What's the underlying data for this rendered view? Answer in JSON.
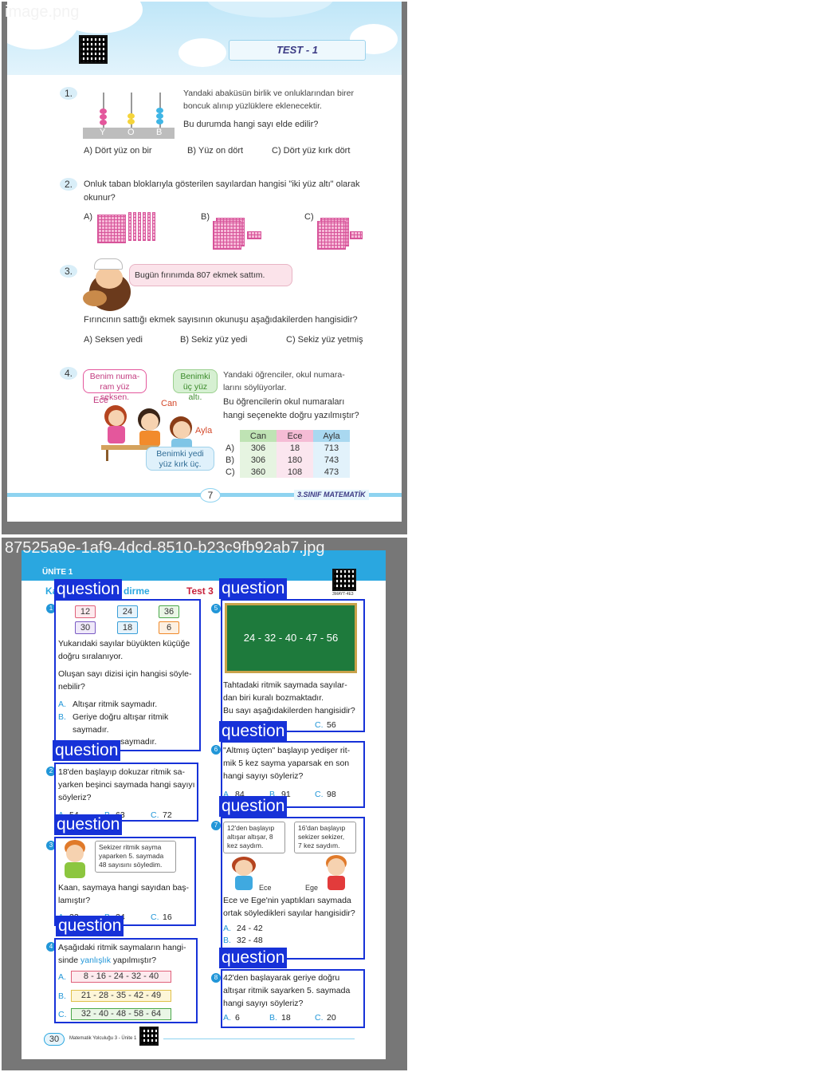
{
  "image1": {
    "filename": "image.png",
    "test_title": "TEST - 1",
    "page_number": "7",
    "footer": "3.SINIF MATEMATİK",
    "q1": {
      "num": "1.",
      "abacus_labels": [
        "Y",
        "O",
        "B"
      ],
      "text1": "Yandaki abaküsün birlik ve onluklarından birer",
      "text2": "boncuk alınıp yüzlüklere eklenecektir.",
      "question": "Bu durumda hangi sayı elde edilir?",
      "options": [
        "A) Dört yüz on bir",
        "B) Yüz on dört",
        "C) Dört yüz kırk dört"
      ]
    },
    "q2": {
      "num": "2.",
      "text1": "Onluk taban bloklarıyla gösterilen sayılardan hangisi \"iki yüz altı\" olarak",
      "text2": "okunur?",
      "options": [
        "A)",
        "B)",
        "C)"
      ]
    },
    "q3": {
      "num": "3.",
      "bubble": "Bugün fırınımda 807 ekmek sattım.",
      "question": "Fırıncının sattığı ekmek sayısının okunuşu aşağıdakilerden hangisidir?",
      "options": [
        "A) Seksen yedi",
        "B) Sekiz yüz yedi",
        "C) Sekiz yüz yetmiş"
      ]
    },
    "q4": {
      "num": "4.",
      "bubble_ece": "Benim numa- ram yüz seksen.",
      "bubble_can": "Benimki üç yüz altı.",
      "bubble_ayla": "Benimki yedi yüz kırk üç.",
      "name_ece": "Ece",
      "name_can": "Can",
      "name_ayla": "Ayla",
      "text1": "Yandaki öğrenciler, okul numara-",
      "text2": "larını söylüyorlar.",
      "question1": "Bu öğrencilerin okul numaraları",
      "question2": "hangi seçenekte doğru yazılmıştır?",
      "headers": [
        "Can",
        "Ece",
        "Ayla"
      ],
      "rows": [
        {
          "label": "A)",
          "values": [
            "306",
            "18",
            "713"
          ]
        },
        {
          "label": "B)",
          "values": [
            "306",
            "180",
            "743"
          ]
        },
        {
          "label": "C)",
          "values": [
            "360",
            "108",
            "473"
          ]
        }
      ]
    }
  },
  "image2": {
    "filename": "87525a9e-1af9-4dcd-8510-b23c9fb92ab7.jpg",
    "unit": "ÜNİTE 1",
    "header_left": "Ka",
    "header_mid": "dirme",
    "test": "Test 3",
    "qr_code_text": "3MAYT-4E3",
    "labels": [
      "question",
      "question",
      "question",
      "question",
      "question",
      "question",
      "question",
      "question"
    ],
    "q1": {
      "num": "1",
      "numbers": [
        "12",
        "24",
        "36",
        "30",
        "18",
        "6"
      ],
      "text": [
        "Yukarıdaki sayılar büyükten küçüğe",
        "doğru sıralanıyor."
      ],
      "question": [
        "Oluşan sayı dizisi için hangisi söyle-",
        "nebilir?"
      ],
      "optA": "Altışar ritmik saymadır.",
      "optB1": "Geriye doğru altışar ritmik",
      "optB2": "saymadır.",
      "optC": "saymadır."
    },
    "q2": {
      "num": "2",
      "text": [
        "18'den başlayıp dokuzar ritmik sa-",
        "yarken beşinci saymada hangi sayıyı",
        "söyleriz?"
      ],
      "optA": "54",
      "optB": "63",
      "optC": "72"
    },
    "q3": {
      "num": "3",
      "bubble": [
        "Sekizer ritmik sayma",
        "yaparken 5. saymada",
        "48 sayısını söyledim."
      ],
      "text": [
        "Kaan, saymaya hangi sayıdan baş-",
        "lamıştır?"
      ],
      "optA": "32",
      "optB": "24",
      "optC": "16"
    },
    "q4": {
      "num": "4",
      "text1": "Aşağıdaki ritmik saymaların hangi-",
      "text2a": "sinde ",
      "text2b": "yanlışlık",
      "text2c": " yapılmıştır?",
      "optA": "8 - 16 - 24 - 32 - 40",
      "optB": "21 - 28 - 35 - 42 - 49",
      "optC": "32 - 40 - 48 - 58 - 64"
    },
    "q5": {
      "num": "5",
      "board": "24 - 32 - 40 - 47 - 56",
      "text": [
        "Tahtadaki ritmik saymada sayılar-",
        "dan biri kuralı bozmaktadır.",
        "Bu sayı aşağıdakilerden hangisidir?"
      ],
      "optC": "56"
    },
    "q6": {
      "num": "6",
      "text": [
        "\"Altmış üçten\" başlayıp yedişer rit-",
        "mik 5 kez sayma yaparsak en son",
        "hangi sayıyı söyleriz?"
      ],
      "optA": "84",
      "optB": "91",
      "optC": "98"
    },
    "q7": {
      "num": "7",
      "bubble_ece": [
        "12'den başlayıp",
        "altışar altışar, 8",
        "kez saydım."
      ],
      "bubble_ege": [
        "16'dan başlayıp",
        "sekizer sekizer,",
        "7 kez saydım."
      ],
      "name_ece": "Ece",
      "name_ege": "Ege",
      "text": [
        "Ece ve Ege'nin yaptıkları saymada",
        "ortak söyledikleri sayılar hangisidir?"
      ],
      "optA": "24 - 42",
      "optB": "32 - 48"
    },
    "q8": {
      "num": "8",
      "text": [
        "42'den başlayarak geriye doğru",
        "altışar ritmik sayarken 5. saymada",
        "hangi sayıyı söyleriz?"
      ],
      "optA": "6",
      "optB": "18",
      "optC": "20"
    },
    "footer_page": "30",
    "footer_text": "Matematik Yolculuğu 3 - Ünite 1",
    "colors": {
      "blue_box": "#1732d8",
      "header_blue": "#2aa7e0",
      "board_green": "#1e7a3c"
    }
  }
}
